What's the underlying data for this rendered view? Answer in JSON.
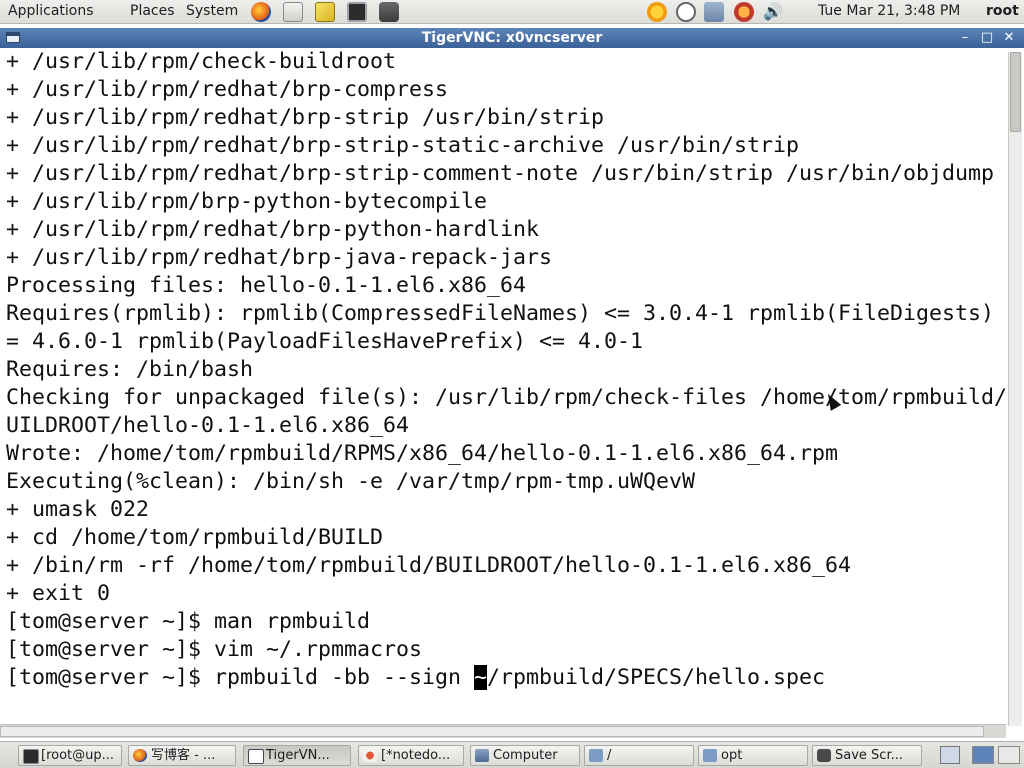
{
  "top_panel": {
    "menus": [
      "Applications",
      "Places",
      "System"
    ],
    "launchers": [
      "firefox-icon",
      "email-icon",
      "text-editor-icon",
      "terminal-icon",
      "screenshot-icon"
    ],
    "tray": [
      "weather-icon",
      "timer-icon",
      "network-icon",
      "update-icon",
      "volume-icon"
    ],
    "clock": "Tue Mar 21,  3:48 PM",
    "user": "root"
  },
  "window": {
    "title": "TigerVNC: x0vncserver",
    "buttons": [
      "minimize",
      "maximize",
      "close"
    ]
  },
  "terminal": {
    "lines": [
      "+ /usr/lib/rpm/check-buildroot",
      "+ /usr/lib/rpm/redhat/brp-compress",
      "+ /usr/lib/rpm/redhat/brp-strip /usr/bin/strip",
      "+ /usr/lib/rpm/redhat/brp-strip-static-archive /usr/bin/strip",
      "+ /usr/lib/rpm/redhat/brp-strip-comment-note /usr/bin/strip /usr/bin/objdump",
      "+ /usr/lib/rpm/brp-python-bytecompile",
      "+ /usr/lib/rpm/redhat/brp-python-hardlink",
      "+ /usr/lib/rpm/redhat/brp-java-repack-jars",
      "Processing files: hello-0.1-1.el6.x86_64",
      "Requires(rpmlib): rpmlib(CompressedFileNames) <= 3.0.4-1 rpmlib(FileDigests)",
      "= 4.6.0-1 rpmlib(PayloadFilesHavePrefix) <= 4.0-1",
      "Requires: /bin/bash",
      "Checking for unpackaged file(s): /usr/lib/rpm/check-files /home/tom/rpmbuild/",
      "UILDROOT/hello-0.1-1.el6.x86_64",
      "Wrote: /home/tom/rpmbuild/RPMS/x86_64/hello-0.1-1.el6.x86_64.rpm",
      "Executing(%clean): /bin/sh -e /var/tmp/rpm-tmp.uWQevW",
      "+ umask 022",
      "+ cd /home/tom/rpmbuild/BUILD",
      "+ /bin/rm -rf /home/tom/rpmbuild/BUILDROOT/hello-0.1-1.el6.x86_64",
      "+ exit 0",
      "[tom@server ~]$ man rpmbuild",
      "[tom@server ~]$ vim ~/.rpmmacros"
    ],
    "prompt_line": {
      "before_cursor": "[tom@server ~]$ rpmbuild -bb --sign ",
      "cursor_char": "~",
      "after_cursor": "/rpmbuild/SPECS/hello.spec"
    }
  },
  "taskbar": {
    "tasks": [
      {
        "label": "[root@up...",
        "icon": "terminal-icon"
      },
      {
        "label": "写博客 - ...",
        "icon": "firefox-icon"
      },
      {
        "label": "TigerVN...",
        "icon": "vnc-icon",
        "active": true
      },
      {
        "label": "[*notedo...",
        "icon": "notes-icon"
      },
      {
        "label": "Computer",
        "icon": "computer-icon"
      },
      {
        "label": "/",
        "icon": "folder-icon"
      },
      {
        "label": "opt",
        "icon": "folder-icon"
      },
      {
        "label": "Save Scr...",
        "icon": "camera-icon"
      }
    ],
    "workspaces": 2,
    "active_workspace": 1
  },
  "colors": {
    "titlebar": "#3b6298",
    "panel": "#dcdcd8",
    "terminal_bg": "#ffffff",
    "terminal_fg": "#111111"
  }
}
